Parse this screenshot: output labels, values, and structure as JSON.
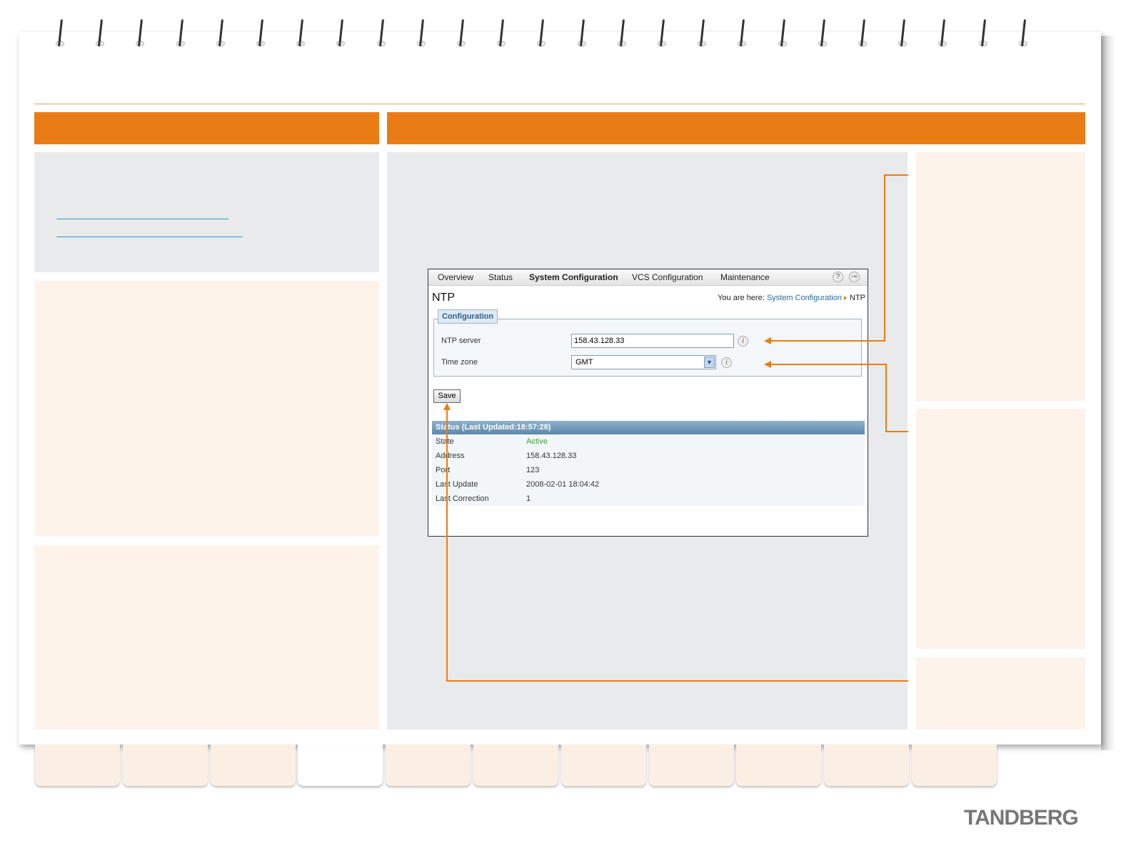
{
  "colors": {
    "accent": "#ea7c16",
    "link": "#2a9bc4",
    "status_active": "#3aa03a"
  },
  "ui": {
    "menu": [
      "Overview",
      "Status",
      "System Configuration",
      "VCS Configuration",
      "Maintenance"
    ],
    "menu_active": "System Configuration",
    "icons": [
      "help-icon",
      "logout-icon"
    ],
    "page_title": "NTP",
    "breadcrumb": {
      "prefix": "You are here:",
      "link": "System Configuration",
      "current": "NTP"
    },
    "config": {
      "legend": "Configuration",
      "ntp_server_label": "NTP server",
      "ntp_server_value": "158.43.128.33",
      "time_zone_label": "Time zone",
      "time_zone_value": "GMT"
    },
    "save_label": "Save",
    "status": {
      "header": "Status (Last Updated:18:57:28)",
      "rows": [
        {
          "label": "State",
          "value": "Active"
        },
        {
          "label": "Address",
          "value": "158.43.128.33"
        },
        {
          "label": "Port",
          "value": "123"
        },
        {
          "label": "Last Update",
          "value": "2008-02-01 18:04:42"
        },
        {
          "label": "Last Correction",
          "value": "1"
        }
      ]
    }
  },
  "logo": "TANDBERG"
}
